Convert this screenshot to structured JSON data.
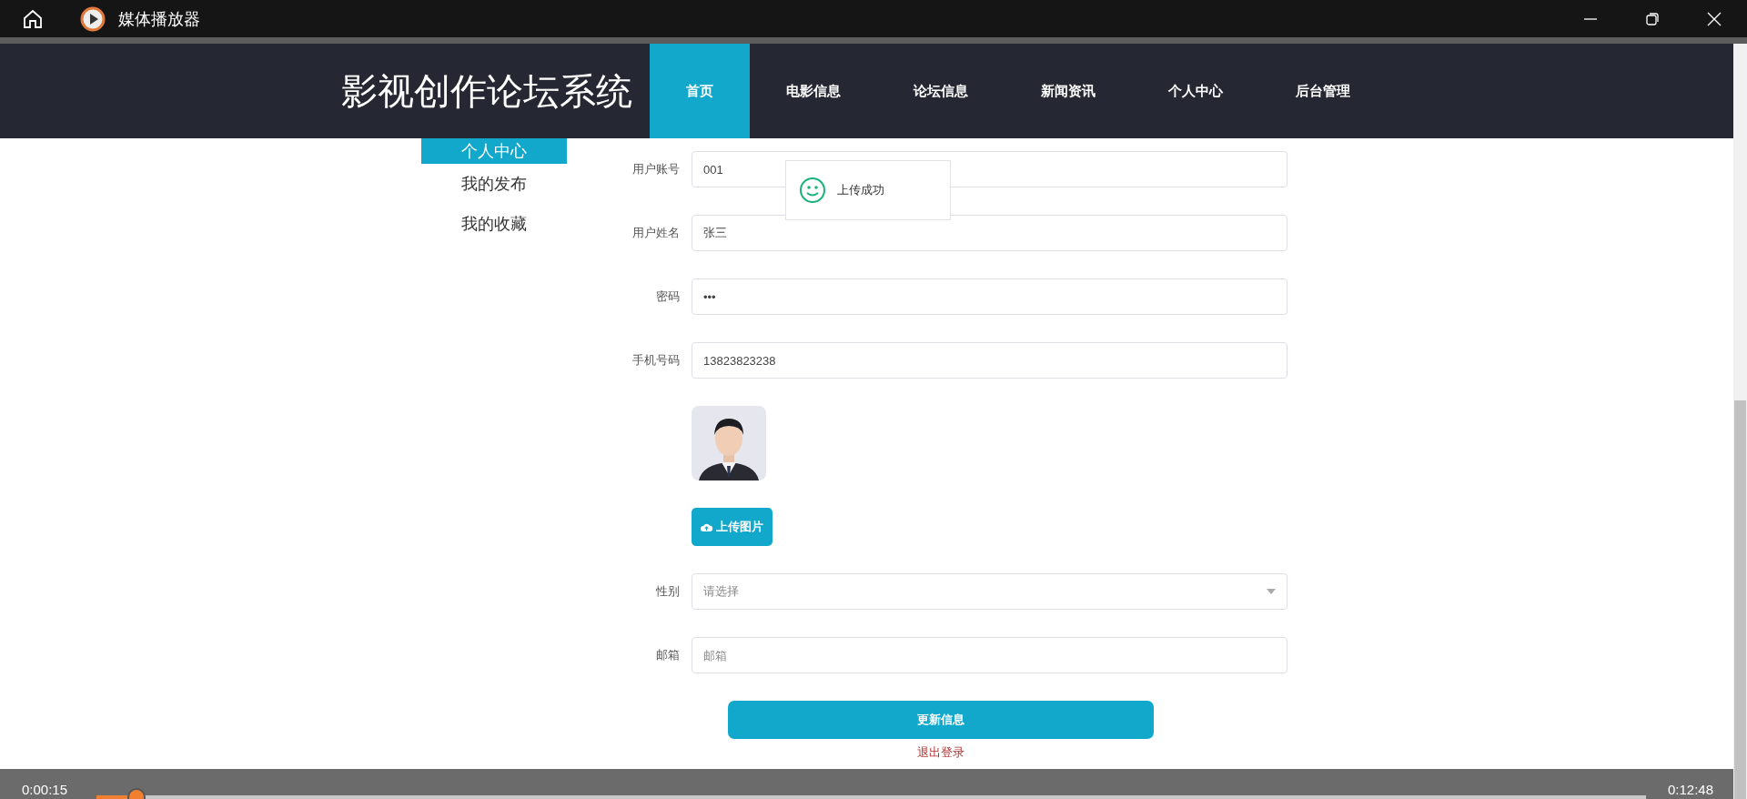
{
  "window": {
    "title": "媒体播放器"
  },
  "site": {
    "title": "影视创作论坛系统",
    "nav": [
      {
        "label": "首页",
        "selected": true
      },
      {
        "label": "电影信息",
        "selected": false
      },
      {
        "label": "论坛信息",
        "selected": false
      },
      {
        "label": "新闻资讯",
        "selected": false
      },
      {
        "label": "个人中心",
        "selected": false
      },
      {
        "label": "后台管理",
        "selected": false
      }
    ]
  },
  "sidebar": {
    "items": [
      {
        "label": "个人中心",
        "selected": true
      },
      {
        "label": "我的发布",
        "selected": false
      },
      {
        "label": "我的收藏",
        "selected": false
      }
    ]
  },
  "form": {
    "fields": [
      {
        "kind": "text",
        "label": "用户账号",
        "value": "001"
      },
      {
        "kind": "text",
        "label": "用户姓名",
        "value": "张三"
      },
      {
        "kind": "text",
        "label": "密码",
        "value": "•••"
      },
      {
        "kind": "text",
        "label": "手机号码",
        "value": "13823823238"
      },
      {
        "kind": "picture"
      },
      {
        "kind": "upload",
        "label": "上传图片"
      },
      {
        "kind": "select",
        "label": "性别",
        "placeholder": "请选择"
      },
      {
        "kind": "text",
        "label": "邮箱",
        "placeholder": "邮箱"
      }
    ],
    "submit": "更新信息",
    "logout": "退出登录"
  },
  "toast": {
    "message": "上传成功"
  },
  "player": {
    "elapsed": "0:00:15",
    "total": "0:12:48",
    "level": 0.026
  }
}
